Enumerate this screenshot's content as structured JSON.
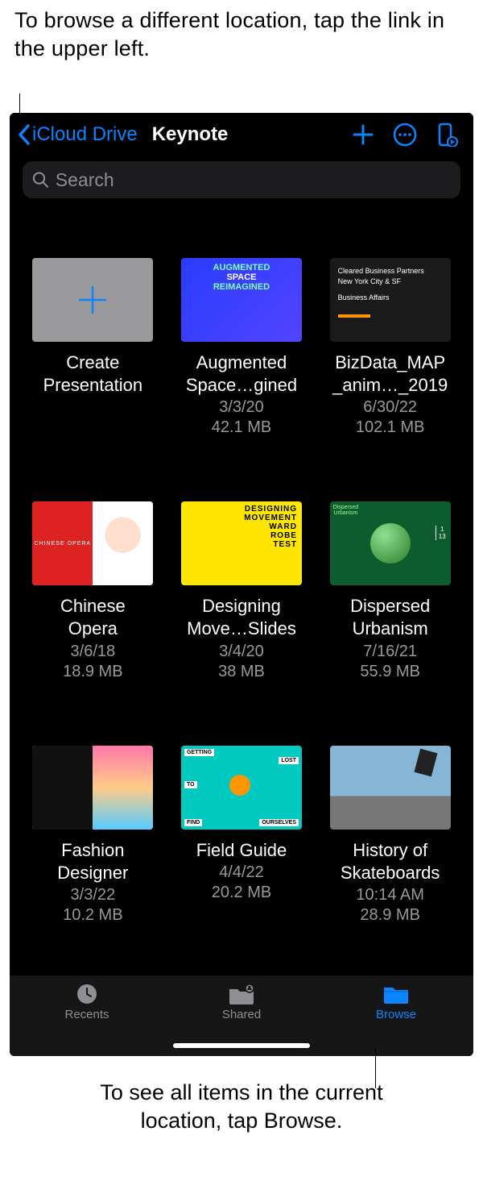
{
  "callouts": {
    "top": "To browse a different location, tap the link in the upper left.",
    "bottom_line1": "To see all items in the current",
    "bottom_line2": "location, tap Browse."
  },
  "nav": {
    "back_label": "iCloud Drive",
    "title": "Keynote"
  },
  "search": {
    "placeholder": "Search"
  },
  "create_tile": {
    "name_line1": "Create",
    "name_line2": "Presentation"
  },
  "files": [
    {
      "name_line1": "Augmented",
      "name_line2": "Space…gined",
      "date": "3/3/20",
      "size": "42.1 MB",
      "thumb": "aug"
    },
    {
      "name_line1": "BizData_MAP",
      "name_line2": "_anim…_2019",
      "date": "6/30/22",
      "size": "102.1 MB",
      "thumb": "biz"
    },
    {
      "name_line1": "Chinese",
      "name_line2": "Opera",
      "date": "3/6/18",
      "size": "18.9 MB",
      "thumb": "opera"
    },
    {
      "name_line1": "Designing",
      "name_line2": "Move…Slides",
      "date": "3/4/20",
      "size": "38 MB",
      "thumb": "design"
    },
    {
      "name_line1": "Dispersed",
      "name_line2": "Urbanism",
      "date": "7/16/21",
      "size": "55.9 MB",
      "thumb": "urban"
    },
    {
      "name_line1": "Fashion",
      "name_line2": "Designer",
      "date": "3/3/22",
      "size": "10.2 MB",
      "thumb": "fashion"
    },
    {
      "name_line1": "Field Guide",
      "name_line2": "",
      "date": "4/4/22",
      "size": "20.2 MB",
      "thumb": "field"
    },
    {
      "name_line1": "History of",
      "name_line2": "Skateboards",
      "date": "10:14 AM",
      "size": "28.9 MB",
      "thumb": "skate"
    }
  ],
  "tabs": {
    "recents": "Recents",
    "shared": "Shared",
    "browse": "Browse"
  },
  "thumb_text": {
    "aug_l1": "AUGMENTED",
    "aug_l2": "SPACE",
    "aug_l3": "REIMAGINED",
    "biz_l1": "Cleared Business Partners",
    "biz_l2": "New York City & SF",
    "biz_l3": "Business Affairs",
    "opera": "CHINESE OPERA",
    "design_l1": "DESIGNING",
    "design_l2": "MOVEMENT",
    "design_l3": "WARD",
    "design_l4": "ROBE",
    "design_l5": "TEST",
    "urban_l1": "Dispersed",
    "urban_l2": "Urbanism",
    "urban_frac": "1\n13",
    "field_w1": "GETTING",
    "field_w2": "LOST",
    "field_w3": "TO",
    "field_w4": "FIND",
    "field_w5": "OURSELVES"
  }
}
